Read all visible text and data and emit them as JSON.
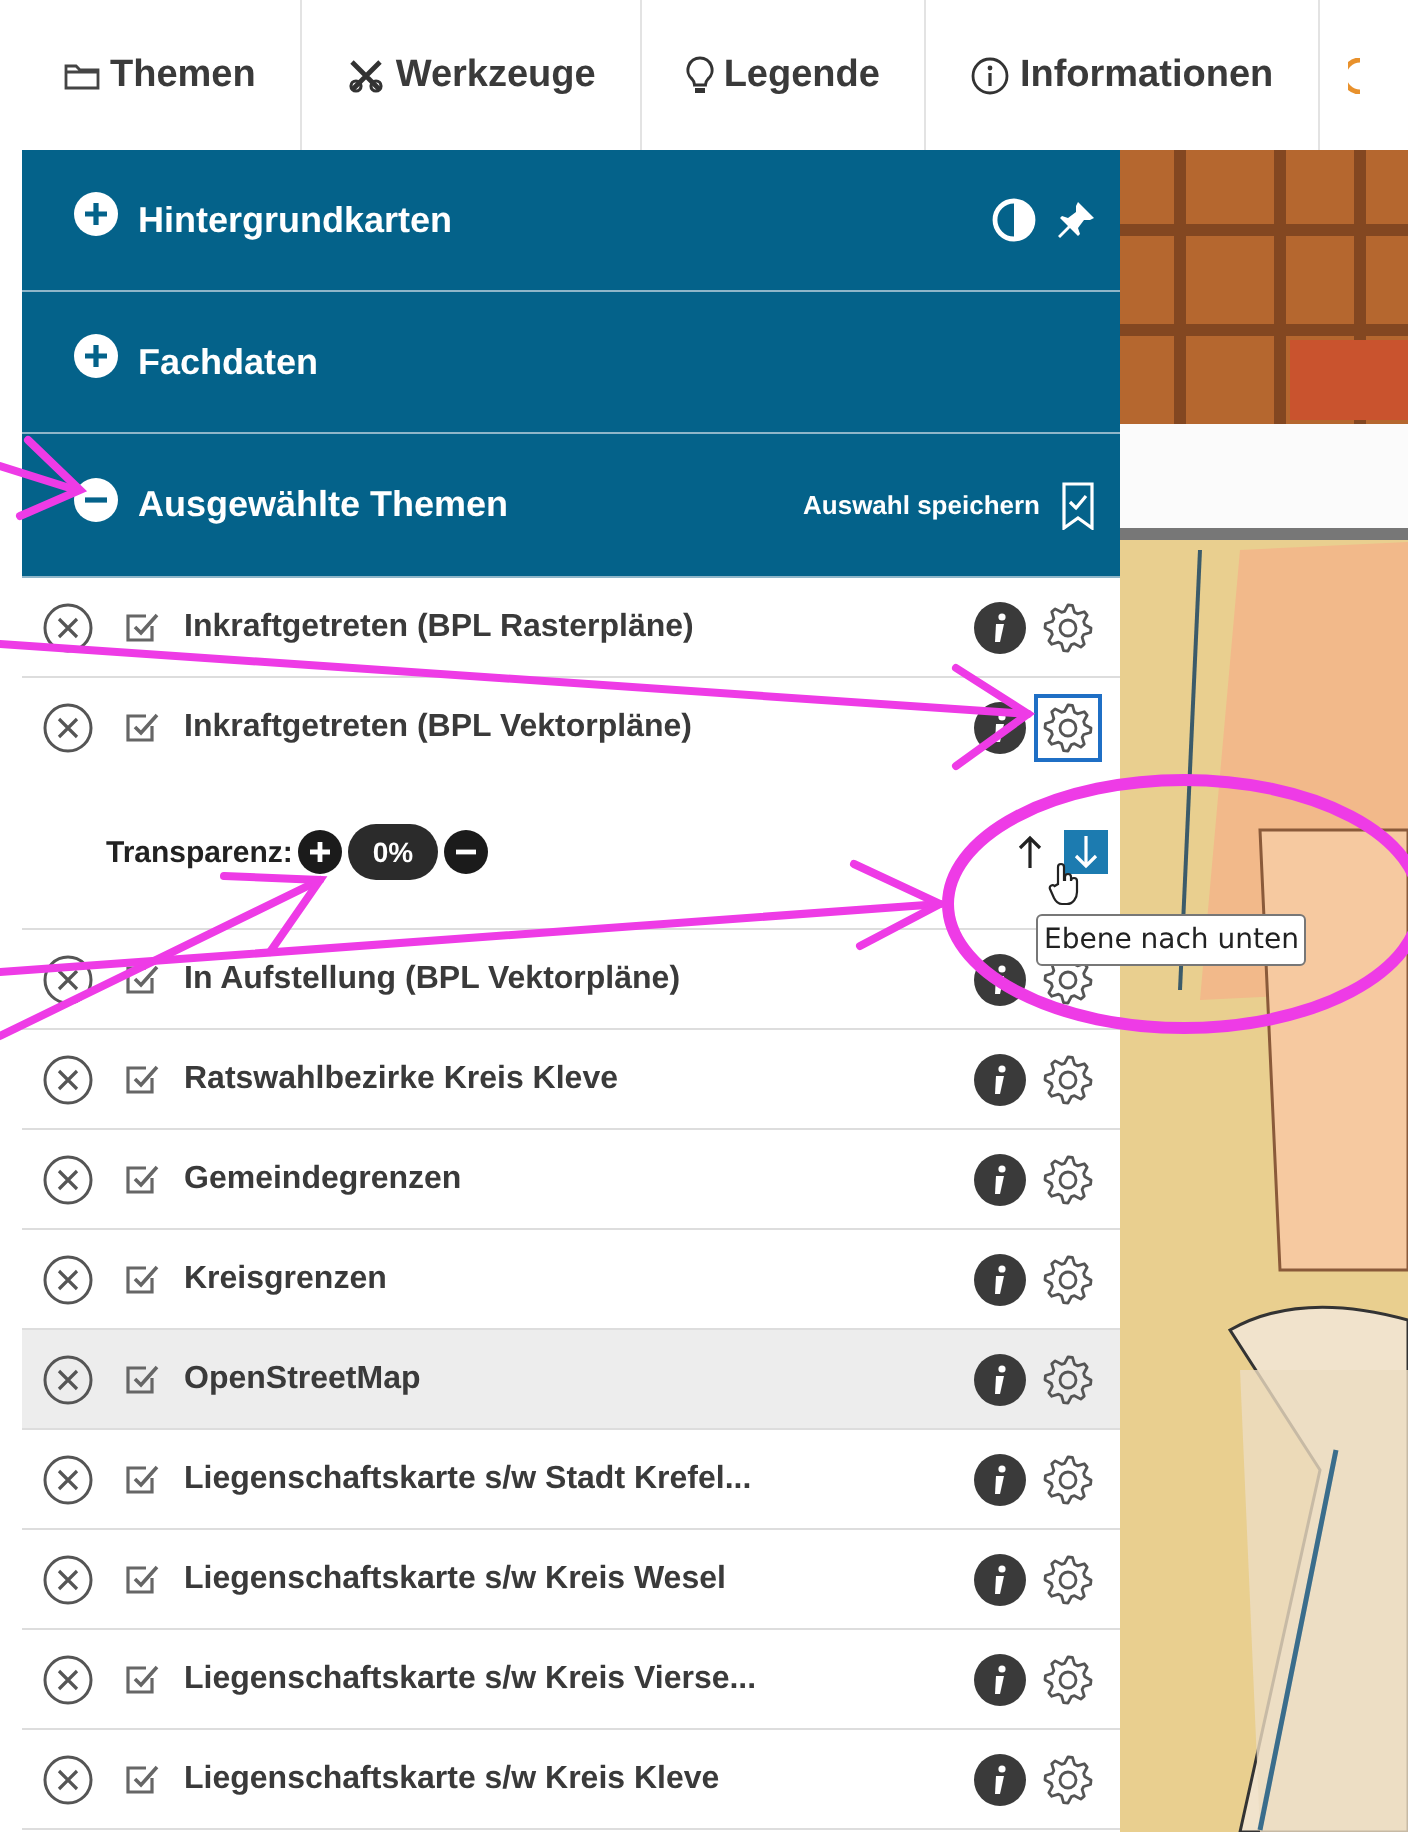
{
  "tabs": [
    {
      "label": "Themen"
    },
    {
      "label": "Werkzeuge"
    },
    {
      "label": "Legende"
    },
    {
      "label": "Informationen"
    }
  ],
  "sections": [
    {
      "title": "Hintergrundkarten",
      "expanded": false,
      "kind": "basemaps"
    },
    {
      "title": "Fachdaten",
      "expanded": false,
      "kind": "plain"
    },
    {
      "title": "Ausgewählte Themen",
      "expanded": true,
      "kind": "selection",
      "save_label": "Auswahl speichern"
    }
  ],
  "layers": [
    {
      "label": "Inkraftgetreten (BPL Rasterpläne)",
      "checked": true,
      "highlighted": false,
      "settings_focused": false,
      "expanded": false
    },
    {
      "label": "Inkraftgetreten (BPL Vektorpläne)",
      "checked": true,
      "highlighted": false,
      "settings_focused": true,
      "expanded": true,
      "transparency": {
        "label": "Transparenz:",
        "value": "0%"
      },
      "order": {
        "up_hovered": false,
        "down_hovered": true,
        "tooltip": "Ebene nach unten"
      }
    },
    {
      "label": "In Aufstellung (BPL Vektorpläne)",
      "checked": true,
      "highlighted": false,
      "settings_focused": false,
      "expanded": false
    },
    {
      "label": "Ratswahlbezirke Kreis Kleve",
      "checked": true,
      "highlighted": false,
      "settings_focused": false,
      "expanded": false
    },
    {
      "label": "Gemeindegrenzen",
      "checked": true,
      "highlighted": false,
      "settings_focused": false,
      "expanded": false
    },
    {
      "label": "Kreisgrenzen",
      "checked": true,
      "highlighted": false,
      "settings_focused": false,
      "expanded": false
    },
    {
      "label": "OpenStreetMap",
      "checked": true,
      "highlighted": true,
      "settings_focused": false,
      "expanded": false
    },
    {
      "label": "Liegenschaftskarte s/w Stadt Krefel...",
      "checked": true,
      "highlighted": false,
      "settings_focused": false,
      "expanded": false
    },
    {
      "label": "Liegenschaftskarte s/w Kreis Wesel",
      "checked": true,
      "highlighted": false,
      "settings_focused": false,
      "expanded": false
    },
    {
      "label": "Liegenschaftskarte s/w Kreis Vierse...",
      "checked": true,
      "highlighted": false,
      "settings_focused": false,
      "expanded": false
    },
    {
      "label": "Liegenschaftskarte s/w Kreis Kleve",
      "checked": true,
      "highlighted": false,
      "settings_focused": false,
      "expanded": false
    }
  ]
}
